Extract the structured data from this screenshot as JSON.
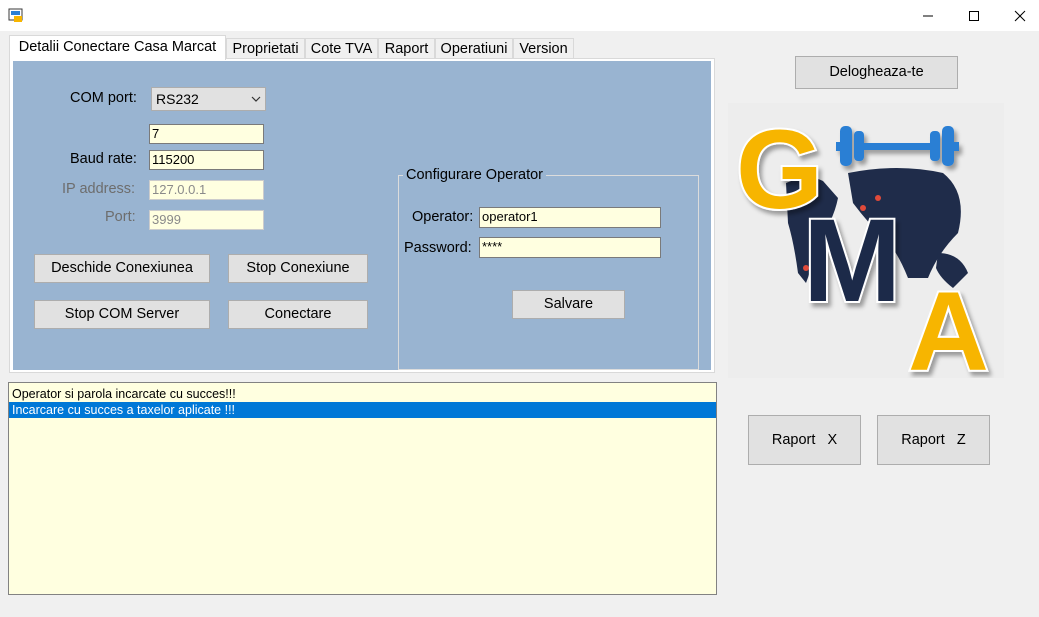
{
  "window": {
    "minimize_glyph": "—",
    "maximize_glyph": "☐",
    "close_glyph": "✕"
  },
  "tabs": [
    {
      "label": "Detalii Conectare Casa Marcat",
      "active": true
    },
    {
      "label": "Proprietati"
    },
    {
      "label": "Cote TVA"
    },
    {
      "label": "Raport"
    },
    {
      "label": "Operatiuni"
    },
    {
      "label": "Version"
    }
  ],
  "connection": {
    "com_port_label": "COM port:",
    "com_port_value": "RS232",
    "extra_value": "7",
    "baud_rate_label": "Baud rate:",
    "baud_rate_value": "115200",
    "ip_label": "IP address:",
    "ip_value": "127.0.0.1",
    "port_label": "Port:",
    "port_value": "3999"
  },
  "buttons": {
    "open_connection": "Deschide Conexiunea",
    "stop_connection": "Stop Conexiune",
    "stop_com_server": "Stop COM Server",
    "connect": "Conectare",
    "save": "Salvare",
    "logout": "Delogheaza-te",
    "report_x": "Raport   X",
    "report_z": "Raport   Z"
  },
  "operator_config": {
    "title": "Configurare Operator",
    "operator_label": "Operator:",
    "operator_value": "operator1",
    "password_label": "Password:",
    "password_value": "****"
  },
  "log": [
    {
      "text": "Operator si parola incarcate cu succes!!!",
      "selected": false
    },
    {
      "text": "Incarcare cu succes a taxelor aplicate !!!",
      "selected": true
    }
  ],
  "logo": {
    "letters": [
      "G",
      "M",
      "A"
    ],
    "colors": {
      "yellow": "#f7b500",
      "navy": "#1f2c4a",
      "blue": "#2a7fd4"
    }
  },
  "colors": {
    "panel_bg": "#99b4d1",
    "input_bg": "#ffffe0",
    "selection": "#0078d7"
  }
}
